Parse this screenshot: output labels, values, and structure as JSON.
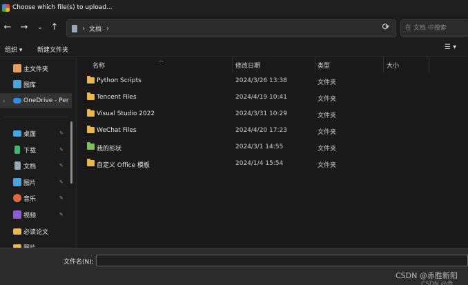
{
  "window": {
    "title": "Choose which file(s) to upload..."
  },
  "nav": {
    "back_icon": "←",
    "forward_icon": "→",
    "recent_icon": "⌄",
    "up_icon": "↑",
    "refresh_icon": "⟳"
  },
  "address": {
    "sep1": "›",
    "location": "文档",
    "sep2": "›",
    "dropdown": "⌄"
  },
  "search": {
    "placeholder": "在 文档 中搜索"
  },
  "toolbar": {
    "organize": "组织 ▾",
    "new_folder": "新建文件夹",
    "view_icon": "☰ ▾"
  },
  "sidebar": {
    "items": [
      {
        "label": "主文件夹",
        "icon": "home-icon",
        "color": "#e8a05a"
      },
      {
        "label": "图库",
        "icon": "gallery-icon",
        "color": "#4aa3df"
      },
      {
        "label": "OneDrive - Per",
        "icon": "onedrive-icon",
        "color": "#2f8fe6"
      },
      {
        "label": "桌面",
        "icon": "desktop-icon",
        "color": "#3fa9e8"
      },
      {
        "label": "下载",
        "icon": "download-icon",
        "color": "#3ab870"
      },
      {
        "label": "文档",
        "icon": "documents-icon",
        "color": "#9aa7b6"
      },
      {
        "label": "图片",
        "icon": "pictures-icon",
        "color": "#4aa3df"
      },
      {
        "label": "音乐",
        "icon": "music-icon",
        "color": "#e2673f"
      },
      {
        "label": "视频",
        "icon": "videos-icon",
        "color": "#8b5cd6"
      },
      {
        "label": "必读论文",
        "icon": "folder-icon",
        "color": "#e9b84a"
      },
      {
        "label": "图片",
        "icon": "folder-icon",
        "color": "#e9b84a"
      }
    ],
    "pin_icon": "📌",
    "expander_icon": "›"
  },
  "columns": {
    "name": "名称",
    "modified": "修改日期",
    "type": "类型",
    "size": "大小",
    "sort_icon": "︿"
  },
  "files": [
    {
      "name": "Python Scripts",
      "modified": "2024/3/26 13:38",
      "type": "文件夹",
      "icon": "folder-icon"
    },
    {
      "name": "Tencent Files",
      "modified": "2024/4/19 10:41",
      "type": "文件夹",
      "icon": "folder-icon"
    },
    {
      "name": "Visual Studio 2022",
      "modified": "2024/3/31 10:29",
      "type": "文件夹",
      "icon": "folder-icon"
    },
    {
      "name": "WeChat Files",
      "modified": "2024/4/20 17:23",
      "type": "文件夹",
      "icon": "folder-icon"
    },
    {
      "name": "我的形状",
      "modified": "2024/3/1 14:55",
      "type": "文件夹",
      "icon": "shapes-folder-icon"
    },
    {
      "name": "自定义 Office 模板",
      "modified": "2024/1/4 15:54",
      "type": "文件夹",
      "icon": "folder-icon"
    }
  ],
  "footer": {
    "filename_label": "文件名(N):",
    "filename_value": ""
  },
  "watermark": {
    "text": "CSDN @赤胜新阳",
    "text2": "CSDN @赤"
  }
}
